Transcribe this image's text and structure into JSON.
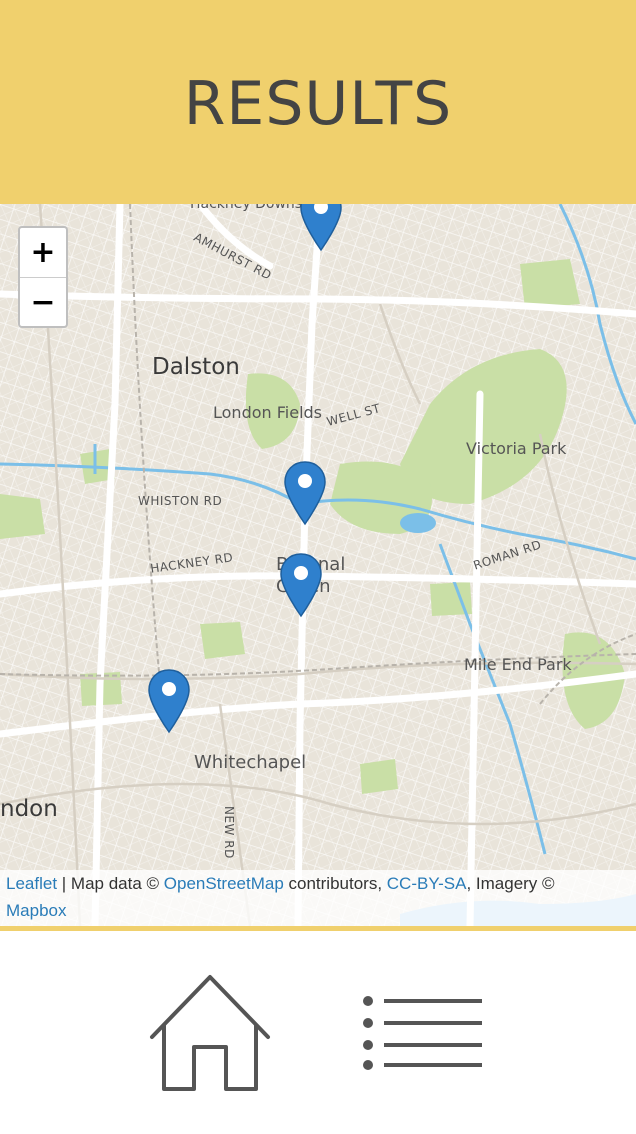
{
  "header": {
    "title": "RESULTS",
    "color": "#f0d06d"
  },
  "map": {
    "zoom_in_label": "+",
    "zoom_out_label": "−",
    "places": {
      "dalston": "Dalston",
      "london_fields": "London Fields",
      "victoria_park": "Victoria Park",
      "bethnal_green": "Bethnal Green",
      "mile_end_park": "Mile End Park",
      "whitechapel": "Whitechapel",
      "london": "ndon",
      "hackney_downs": "Hackney Downs"
    },
    "roads": {
      "amhurst": "AMHURST RD",
      "well_st": "WELL ST",
      "whiston": "WHISTON RD",
      "hackney_rd": "HACKNEY RD",
      "roman_rd": "ROMAN RD",
      "new_rd": "NEW RD"
    },
    "marker_color": "#2f80cd",
    "markers": [
      {
        "name": "marker-hackney-downs"
      },
      {
        "name": "marker-london-fields"
      },
      {
        "name": "marker-bethnal-green"
      },
      {
        "name": "marker-whitechapel"
      }
    ],
    "attribution": {
      "leaflet": "Leaflet",
      "sep": " | Map data © ",
      "osm": "OpenStreetMap",
      "contrib": " contributors, ",
      "license": "CC-BY-SA",
      "imagery": ", Imagery © ",
      "mapbox": "Mapbox"
    }
  },
  "footer": {
    "home_icon": "home-icon",
    "list_icon": "list-icon"
  }
}
